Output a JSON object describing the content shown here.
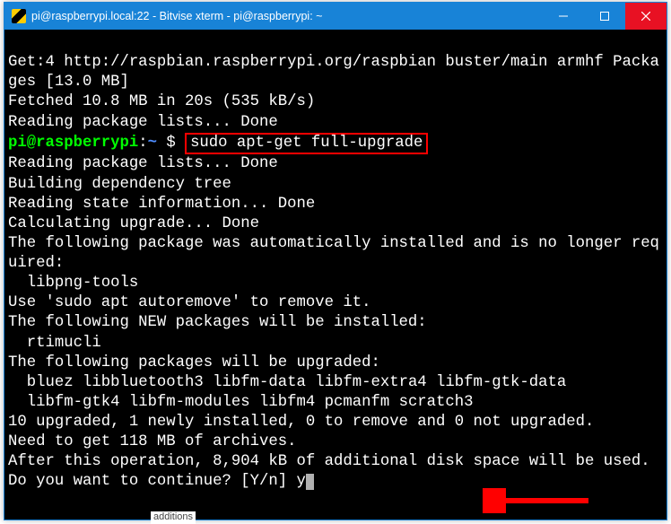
{
  "window": {
    "title": "pi@raspberrypi.local:22 - Bitvise xterm - pi@raspberrypi: ~"
  },
  "term": {
    "l1": "Get:4 http://raspbian.raspberrypi.org/raspbian buster/main armhf Packages [13.0 MB]",
    "l2": "Fetched 10.8 MB in 20s (535 kB/s)",
    "l3": "Reading package lists... Done",
    "prompt_user": "pi@raspberrypi",
    "prompt_path": "~",
    "prompt_sep": ":",
    "prompt_symbol": "$",
    "cmd_boxed": "sudo apt-get full-upgrade",
    "l5": "Reading package lists... Done",
    "l6": "Building dependency tree",
    "l7": "Reading state information... Done",
    "l8": "Calculating upgrade... Done",
    "l9": "The following package was automatically installed and is no longer required:",
    "l10": "  libpng-tools",
    "l11": "Use 'sudo apt autoremove' to remove it.",
    "l12": "The following NEW packages will be installed:",
    "l13": "  rtimucli",
    "l14": "The following packages will be upgraded:",
    "l15": "  bluez libbluetooth3 libfm-data libfm-extra4 libfm-gtk-data",
    "l16": "  libfm-gtk4 libfm-modules libfm4 pcmanfm scratch3",
    "l17": "10 upgraded, 1 newly installed, 0 to remove and 0 not upgraded.",
    "l18": "Need to get 118 MB of archives.",
    "l19": "After this operation, 8,904 kB of additional disk space will be used.",
    "l20": "Do you want to continue? [Y/n] ",
    "answer": "y"
  },
  "taskbar": {
    "snippet": "additions"
  }
}
